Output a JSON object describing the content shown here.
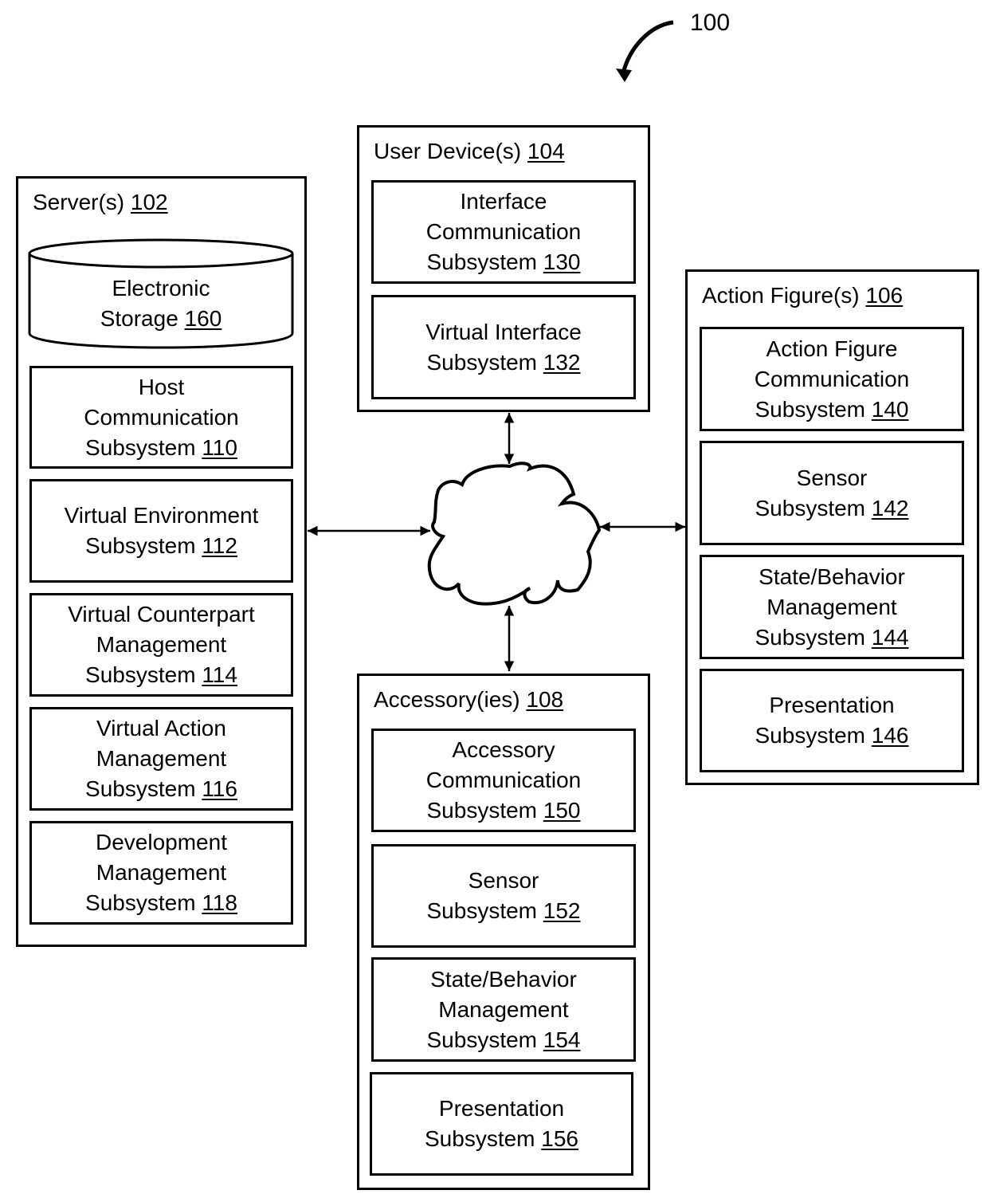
{
  "figure": {
    "ref_number": "100"
  },
  "servers": {
    "title": "Server(s)",
    "number": "102",
    "storage": {
      "lines": [
        "Electronic",
        "Storage"
      ],
      "number": "160"
    },
    "subsystems": [
      {
        "lines": [
          "Host",
          "Communication",
          "Subsystem"
        ],
        "number": "110"
      },
      {
        "lines": [
          "Virtual Environment",
          "Subsystem"
        ],
        "number": "112"
      },
      {
        "lines": [
          "Virtual Counterpart",
          "Management",
          "Subsystem"
        ],
        "number": "114"
      },
      {
        "lines": [
          "Virtual Action",
          "Management",
          "Subsystem"
        ],
        "number": "116"
      },
      {
        "lines": [
          "Development",
          "Management",
          "Subsystem"
        ],
        "number": "118"
      }
    ]
  },
  "user_devices": {
    "title": "User Device(s)",
    "number": "104",
    "subsystems": [
      {
        "lines": [
          "Interface",
          "Communication",
          "Subsystem"
        ],
        "number": "130"
      },
      {
        "lines": [
          "Virtual Interface",
          "Subsystem"
        ],
        "number": "132"
      }
    ]
  },
  "action_figures": {
    "title": "Action Figure(s)",
    "number": "106",
    "subsystems": [
      {
        "lines": [
          "Action Figure",
          "Communication",
          "Subsystem"
        ],
        "number": "140"
      },
      {
        "lines": [
          "Sensor",
          "Subsystem"
        ],
        "number": "142"
      },
      {
        "lines": [
          "State/Behavior",
          "Management",
          "Subsystem"
        ],
        "number": "144"
      },
      {
        "lines": [
          "Presentation",
          "Subsystem"
        ],
        "number": "146"
      }
    ]
  },
  "accessories": {
    "title": "Accessory(ies)",
    "number": "108",
    "subsystems": [
      {
        "lines": [
          "Accessory",
          "Communication",
          "Subsystem"
        ],
        "number": "150"
      },
      {
        "lines": [
          "Sensor",
          "Subsystem"
        ],
        "number": "152"
      },
      {
        "lines": [
          "State/Behavior",
          "Management",
          "Subsystem"
        ],
        "number": "154"
      },
      {
        "lines": [
          "Presentation",
          "Subsystem"
        ],
        "number": "156"
      }
    ]
  },
  "network": {
    "icon": "cloud-icon"
  }
}
